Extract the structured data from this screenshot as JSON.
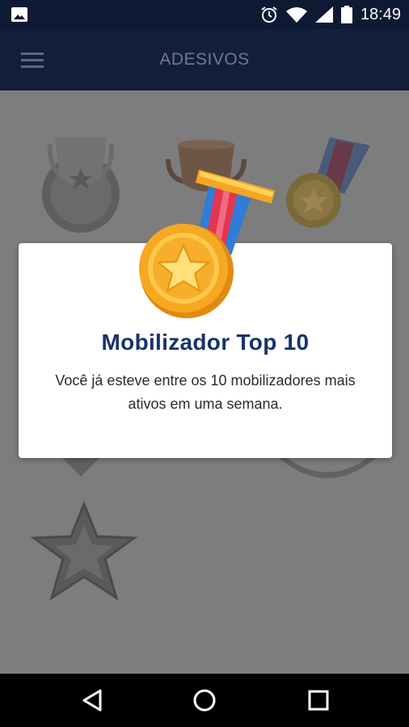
{
  "status_bar": {
    "time": "18:49",
    "icons": [
      "image-icon",
      "alarm-icon",
      "wifi-icon",
      "signal-icon",
      "battery-icon"
    ]
  },
  "app_bar": {
    "title": "ADESIVOS",
    "menu_icon": "hamburger-menu-icon"
  },
  "badges": [
    {
      "name": "trophy-silver",
      "state": "locked"
    },
    {
      "name": "trophy-bronze",
      "state": "unlocked"
    },
    {
      "name": "medal-gold",
      "state": "unlocked"
    },
    {
      "name": "badge-hidden-left",
      "state": "locked"
    },
    {
      "name": "badge-hidden-center",
      "state": "locked"
    },
    {
      "name": "badge-hidden-right",
      "state": "locked"
    },
    {
      "name": "star-badge",
      "state": "locked"
    }
  ],
  "dialog": {
    "title": "Mobilizador Top 10",
    "message": "Você já esteve entre os 10 mobilizadores mais ativos em uma semana.",
    "icon": "medal-icon"
  },
  "nav_bar": {
    "buttons": [
      "back-icon",
      "home-icon",
      "recents-icon"
    ]
  },
  "colors": {
    "app_bar": "#131f3a",
    "status_bar": "#0e1a33",
    "dialog_title": "#18326e",
    "scrim": "#7d7d7d"
  }
}
